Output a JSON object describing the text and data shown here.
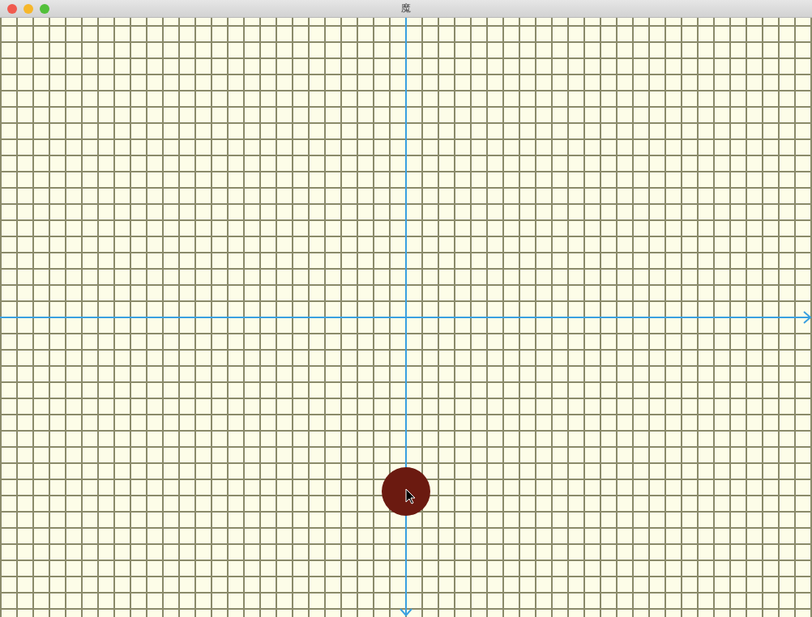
{
  "window": {
    "title": "魔"
  }
}
